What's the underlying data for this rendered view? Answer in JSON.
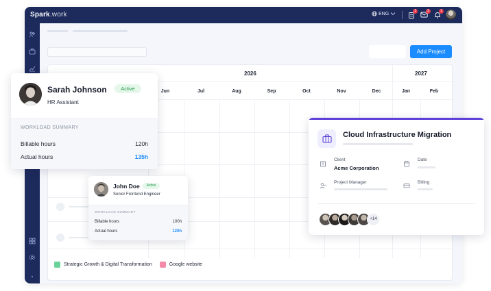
{
  "app": {
    "logo_bold": "Spark",
    "logo_light": ".work",
    "language": "ENG",
    "notifications": {
      "tasks": "1",
      "mail": "3",
      "bell": "1"
    }
  },
  "toolbar": {
    "add_project_label": "Add Project"
  },
  "timeline": {
    "years": [
      "2026",
      "2027"
    ],
    "months": [
      "Jun",
      "Jul",
      "Aug",
      "Sep",
      "Oct",
      "Nov",
      "Dec",
      "Jan",
      "Feb"
    ]
  },
  "legend": [
    {
      "label": "Strategic Growth & Digital Transformation",
      "color": "#6bd39a"
    },
    {
      "label": "Google website",
      "color": "#f48aa8"
    }
  ],
  "sarah_card": {
    "name": "Sarah Johnson",
    "status": "Active",
    "role": "HR Assistant",
    "workload_title": "WORKLOAD SUMMARY",
    "billable_label": "Billable hours",
    "billable_value": "120h",
    "actual_label": "Actual hours",
    "actual_value": "135h"
  },
  "john_card": {
    "name": "John Doe",
    "status": "Active",
    "role": "Senior Frontend Engineer",
    "workload_title": "WORKLOAD SUMMARY",
    "billable_label": "Billable hours",
    "billable_value": "100h",
    "actual_label": "Actual hours",
    "actual_value": "120h"
  },
  "project_card": {
    "title": "Cloud Infrastructure Migration",
    "client_label": "Client",
    "client_value": "Acme Corporation",
    "date_label": "Date",
    "pm_label": "Project Manager",
    "billing_label": "Billing",
    "more_members": "+14"
  },
  "colors": {
    "navy": "#1c2a5c",
    "accent_blue": "#1a8cff",
    "active_green": "#1f9a4a",
    "project_purple": "#5b3fd8"
  }
}
